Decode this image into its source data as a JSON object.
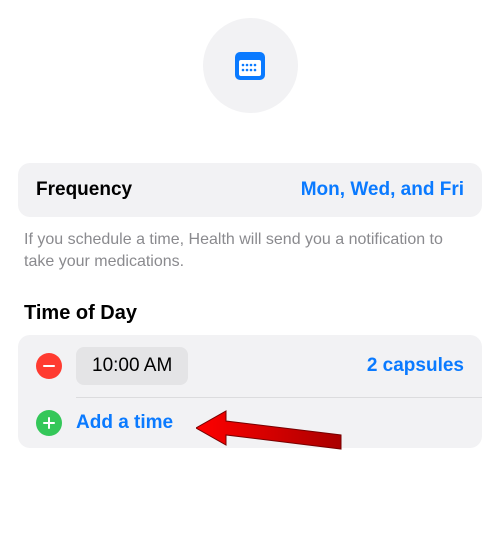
{
  "top_icon": "calendar-icon",
  "frequency": {
    "label": "Frequency",
    "value": "Mon, Wed, and Fri"
  },
  "help_text": "If you schedule a time, Health will send you a notification to take your medications.",
  "time_of_day": {
    "title": "Time of Day",
    "entries": [
      {
        "time": "10:00 AM",
        "dose": "2 capsules"
      }
    ],
    "add_label": "Add a time"
  },
  "colors": {
    "accent": "#0a7aff",
    "remove": "#ff3b30",
    "add": "#34c759",
    "panel": "#f2f2f4"
  }
}
